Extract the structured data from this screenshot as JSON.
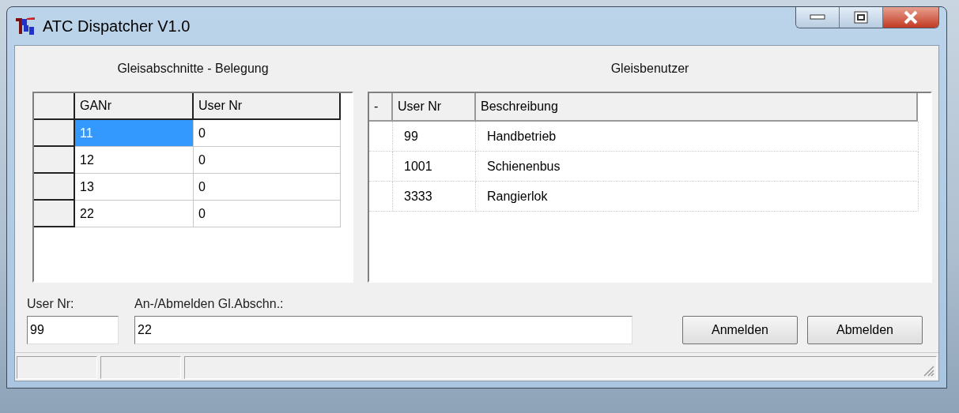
{
  "window": {
    "title": "ATC Dispatcher V1.0"
  },
  "occupancy": {
    "title": "Gleisabschnitte - Belegung",
    "columns": [
      "GANr",
      "User Nr"
    ],
    "rows": [
      {
        "cells": [
          "11",
          "0"
        ],
        "selected": true
      },
      {
        "cells": [
          "12",
          "0"
        ],
        "selected": false
      },
      {
        "cells": [
          "13",
          "0"
        ],
        "selected": false
      },
      {
        "cells": [
          "22",
          "0"
        ],
        "selected": false
      }
    ]
  },
  "users": {
    "title": "Gleisbenutzer",
    "columns": [
      "-",
      "User Nr",
      "Beschreibung"
    ],
    "rows": [
      {
        "cells": [
          "",
          "99",
          "Handbetrieb"
        ]
      },
      {
        "cells": [
          "",
          "1001",
          "Schienenbus"
        ]
      },
      {
        "cells": [
          "",
          "3333",
          "Rangierlok"
        ]
      }
    ]
  },
  "form": {
    "user_nr": {
      "label": "User Nr:",
      "value": "99"
    },
    "section": {
      "label": "An-/Abmelden Gl.Abschn.:",
      "value": "22"
    },
    "buttons": [
      "Anmelden",
      "Abmelden"
    ]
  }
}
